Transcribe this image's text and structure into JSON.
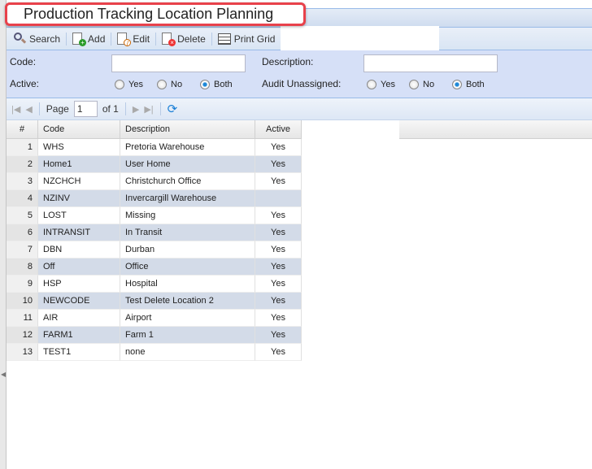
{
  "title": "Production Tracking Location Planning",
  "toolbar": {
    "search": "Search",
    "add": "Add",
    "edit": "Edit",
    "delete": "Delete",
    "print": "Print Grid"
  },
  "filters": {
    "code_label": "Code:",
    "code_value": "",
    "description_label": "Description:",
    "description_value": "",
    "active_label": "Active:",
    "audit_label": "Audit Unassigned:",
    "options": [
      "Yes",
      "No",
      "Both"
    ],
    "active_selected": "Both",
    "audit_selected": "Both"
  },
  "pager": {
    "page_label": "Page",
    "page": "1",
    "of": "of 1"
  },
  "grid": {
    "columns": [
      "#",
      "Code",
      "Description",
      "Active"
    ],
    "rows": [
      [
        "1",
        "WHS",
        "Pretoria Warehouse",
        "Yes"
      ],
      [
        "2",
        "Home1",
        "User Home",
        "Yes"
      ],
      [
        "3",
        "NZCHCH",
        "Christchurch Office",
        "Yes"
      ],
      [
        "4",
        "NZINV",
        "Invercargill Warehouse",
        ""
      ],
      [
        "5",
        "LOST",
        "Missing",
        "Yes"
      ],
      [
        "6",
        "INTRANSIT",
        "In Transit",
        "Yes"
      ],
      [
        "7",
        "DBN",
        "Durban",
        "Yes"
      ],
      [
        "8",
        "Off",
        "Office",
        "Yes"
      ],
      [
        "9",
        "HSP",
        "Hospital",
        "Yes"
      ],
      [
        "10",
        "NEWCODE",
        "Test Delete Location 2",
        "Yes"
      ],
      [
        "11",
        "AIR",
        "Airport",
        "Yes"
      ],
      [
        "12",
        "FARM1",
        "Farm 1",
        "Yes"
      ],
      [
        "13",
        "TEST1",
        "none",
        "Yes"
      ]
    ]
  },
  "colors": {
    "accent": "#e8414b",
    "panel": "#d6e0f7",
    "border": "#99bbe8",
    "alt_row": "#d3dbe8"
  }
}
